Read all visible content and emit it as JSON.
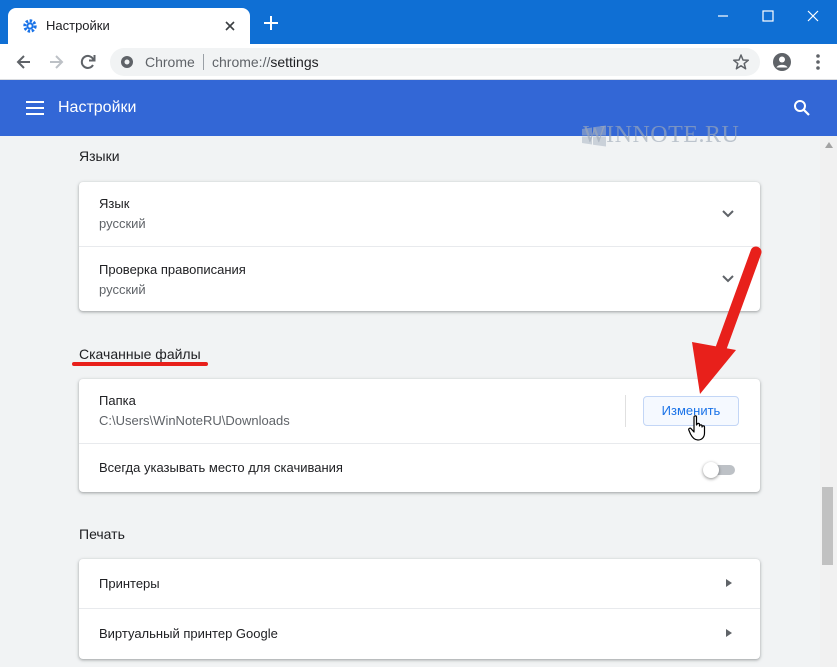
{
  "browser": {
    "tab_title": "Настройки",
    "omnibox_chip": "Chrome",
    "url_scheme": "chrome://",
    "url_path": "settings"
  },
  "settings": {
    "header_title": "Настройки",
    "watermark": "WINNOTE.RU",
    "languages": {
      "section_title": "Языки",
      "language_label": "Язык",
      "language_value": "русский",
      "spellcheck_label": "Проверка правописания",
      "spellcheck_value": "русский"
    },
    "downloads": {
      "section_title": "Скачанные файлы",
      "folder_label": "Папка",
      "folder_path": "C:\\Users\\WinNoteRU\\Downloads",
      "change_button": "Изменить",
      "ask_location_label": "Всегда указывать место для скачивания",
      "ask_location_enabled": false
    },
    "printing": {
      "section_title": "Печать",
      "printers_label": "Принтеры",
      "cloud_printer_label": "Виртуальный принтер Google"
    }
  },
  "colors": {
    "titlebar": "#0f6fd4",
    "settings_header": "#3367d6",
    "accent": "#1a73e8",
    "annotation_red": "#e8201b"
  }
}
